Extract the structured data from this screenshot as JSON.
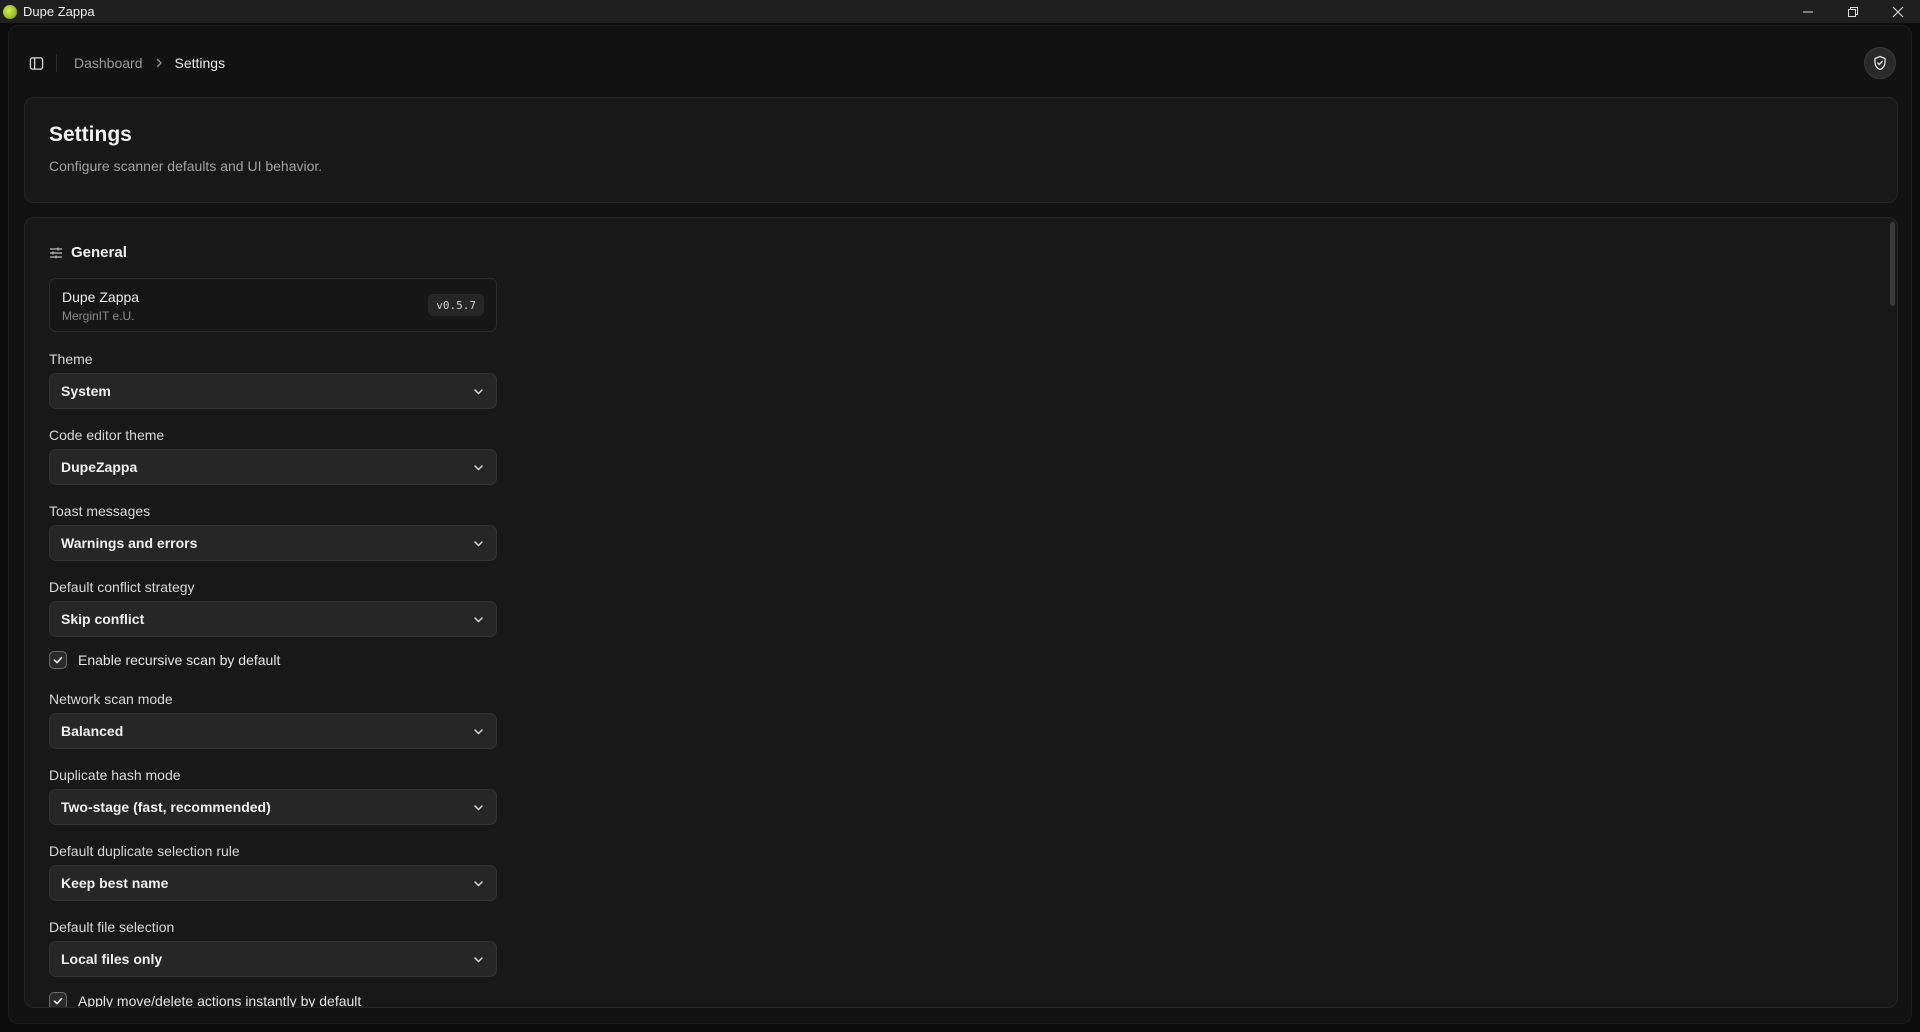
{
  "window": {
    "title": "Dupe Zappa",
    "minimize_glyph": "—",
    "restore_glyph": "❐",
    "close_glyph": "✕"
  },
  "topbar": {
    "breadcrumb": {
      "parent": "Dashboard",
      "current": "Settings"
    },
    "sidebar_toggle_icon": "sidebar-panel-icon",
    "status_icon": "shield-check-icon"
  },
  "header": {
    "title": "Settings",
    "subtitle": "Configure scanner defaults and UI behavior."
  },
  "general": {
    "section_title": "General",
    "section_icon": "sliders-icon",
    "about": {
      "app_name": "Dupe Zappa",
      "company": "MerginIT e.U.",
      "version": "v0.5.7"
    },
    "fields": [
      {
        "label": "Theme",
        "value": "System"
      },
      {
        "label": "Code editor theme",
        "value": "DupeZappa"
      },
      {
        "label": "Toast messages",
        "value": "Warnings and errors"
      },
      {
        "label": "Default conflict strategy",
        "value": "Skip conflict"
      },
      {
        "label": "Network scan mode",
        "value": "Balanced"
      },
      {
        "label": "Duplicate hash mode",
        "value": "Two-stage (fast, recommended)"
      },
      {
        "label": "Default duplicate selection rule",
        "value": "Keep best name"
      },
      {
        "label": "Default file selection",
        "value": "Local files only"
      }
    ],
    "checkboxes": [
      {
        "label": "Enable recursive scan by default",
        "checked": true
      },
      {
        "label": "Apply move/delete actions instantly by default",
        "checked": true
      }
    ]
  },
  "colors": {
    "background": "#0b0b0b",
    "app_surface": "#121212",
    "card": "#181818",
    "select_bg": "#262626",
    "text_primary": "#f0f0f0",
    "text_muted": "#a0a0a0"
  }
}
